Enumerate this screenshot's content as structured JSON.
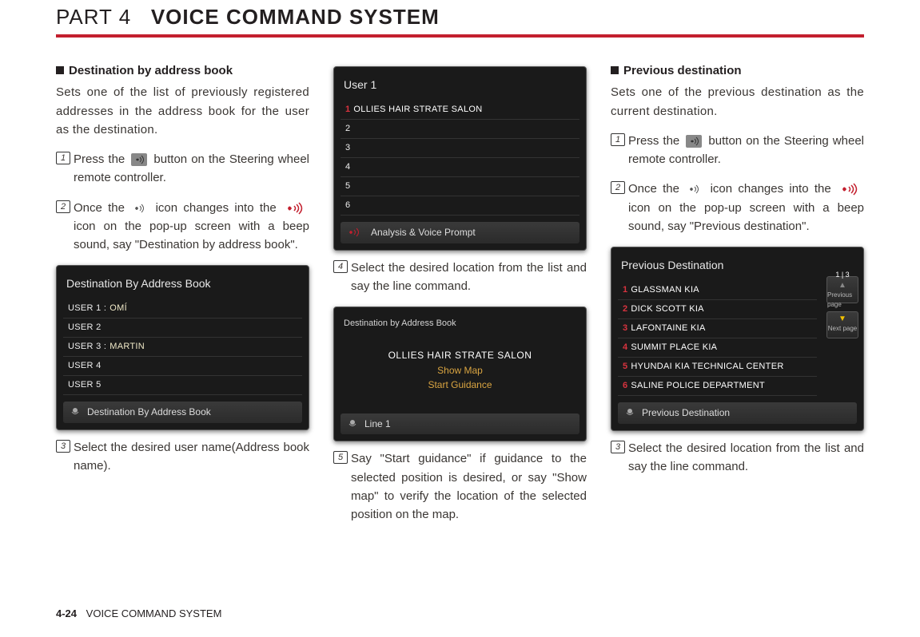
{
  "header": {
    "part": "PART 4",
    "title": "VOICE COMMAND SYSTEM"
  },
  "footer": {
    "pagenum": "4-24",
    "label": "VOICE COMMAND SYSTEM"
  },
  "col1": {
    "title": "Destination by address book",
    "lead": "Sets one of the list of previously registered addresses in the address book for the user as the destination.",
    "step1a": "Press the ",
    "step1b": " button on the Steering wheel remote controller.",
    "step2a": "Once the ",
    "step2b": " icon changes into the ",
    "step2c": " icon on the pop-up screen with a beep sound, say \"Destination by address book\".",
    "step3": "Select the desired user name(Address book name).",
    "screen": {
      "title": "Destination By Address Book",
      "rows": [
        {
          "label": "USER 1 :",
          "val": "OMÍ"
        },
        {
          "label": "USER 2",
          "val": ""
        },
        {
          "label": "USER 3 :",
          "val": "MARTIN"
        },
        {
          "label": "USER 4",
          "val": ""
        },
        {
          "label": "USER 5",
          "val": ""
        }
      ],
      "footer": "Destination By Address Book"
    }
  },
  "col2": {
    "screenA": {
      "title": "User 1",
      "rows": [
        "1 OLLIES HAIR STRATE SALON",
        "2",
        "3",
        "4",
        "5",
        "6"
      ],
      "footer": "Analysis & Voice Prompt"
    },
    "step4": "Select the desired location from the list and say the line command.",
    "screenB": {
      "title": "Destination by Address Book",
      "main": "OLLIES HAIR STRATE SALON",
      "opt1": "Show Map",
      "opt2": "Start Guidance",
      "footer": "Line 1"
    },
    "step5": "Say \"Start guidance\" if guidance to the selected position is desired, or say \"Show map\" to verify the location of the selected position on the map."
  },
  "col3": {
    "title": "Previous destination",
    "lead": "Sets one of the previous destination as the current destination.",
    "step1a": "Press the ",
    "step1b": " button on the Steering wheel remote controller.",
    "step2a": "Once the ",
    "step2b": " icon changes into the ",
    "step2c": " icon on the pop-up screen with a beep sound, say \"Previous destination\".",
    "step3": "Select the desired location from the list and say the line command.",
    "screen": {
      "title": "Previous Destination",
      "rows": [
        "1 GLASSMAN KIA",
        "2 DICK SCOTT KIA",
        "3 LAFONTAINE KIA",
        "4 SUMMIT PLACE KIA",
        "5 HYUNDAI KIA TECHNICAL CENTER",
        "6 SALINE POLICE DEPARTMENT"
      ],
      "footer": "Previous Destination",
      "prevpage": {
        "pg": "1 | 3",
        "label": "Previous page"
      },
      "nextpage": {
        "label": "Next page"
      }
    }
  }
}
